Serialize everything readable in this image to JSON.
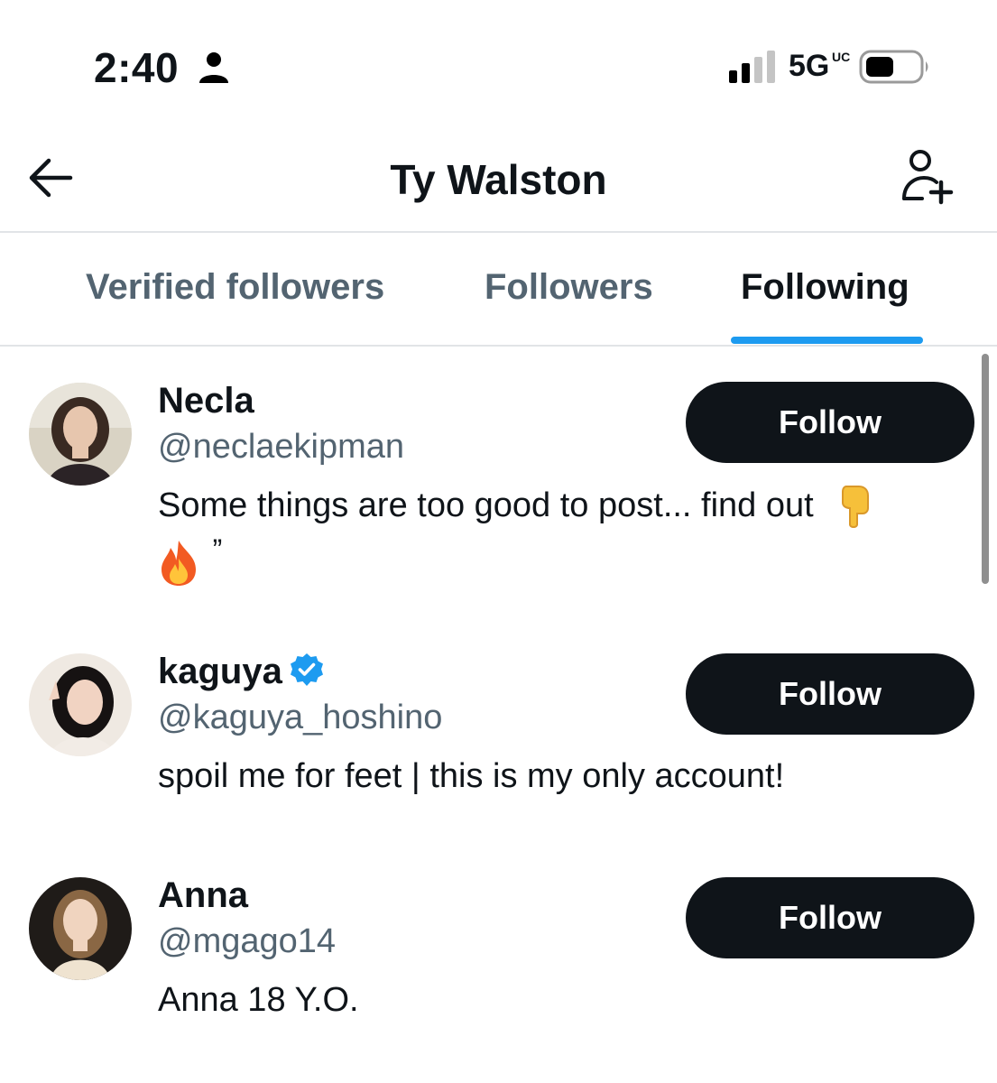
{
  "status_bar": {
    "time": "2:40",
    "network": "5G",
    "network_superscript": "UC"
  },
  "header": {
    "title": "Ty Walston"
  },
  "tabs": [
    {
      "label": "Verified followers",
      "active": false
    },
    {
      "label": "Followers",
      "active": false
    },
    {
      "label": "Following",
      "active": true
    }
  ],
  "users": [
    {
      "name": "Necla",
      "handle": "@neclaekipman",
      "verified": false,
      "bio_line1": "Some things are too good to post... find out",
      "bio_line2": "”",
      "follow_label": "Follow"
    },
    {
      "name": "kaguya",
      "handle": "@kaguya_hoshino",
      "verified": true,
      "bio_line1": "spoil me for feet | this is my only account!",
      "follow_label": "Follow"
    },
    {
      "name": "Anna",
      "handle": "@mgago14",
      "verified": false,
      "bio_line1": "Anna 18 Y.O.",
      "follow_label": "Follow"
    }
  ],
  "colors": {
    "accent": "#1d9bf0",
    "text_primary": "#0f1419",
    "text_secondary": "#536471",
    "button_bg": "#0f1419",
    "divider": "#e1e4e7"
  },
  "icons": [
    "person-icon",
    "signal-icon",
    "battery-icon",
    "back-arrow-icon",
    "add-user-icon",
    "verified-badge-icon",
    "pointing-down-emoji",
    "fire-emoji"
  ]
}
